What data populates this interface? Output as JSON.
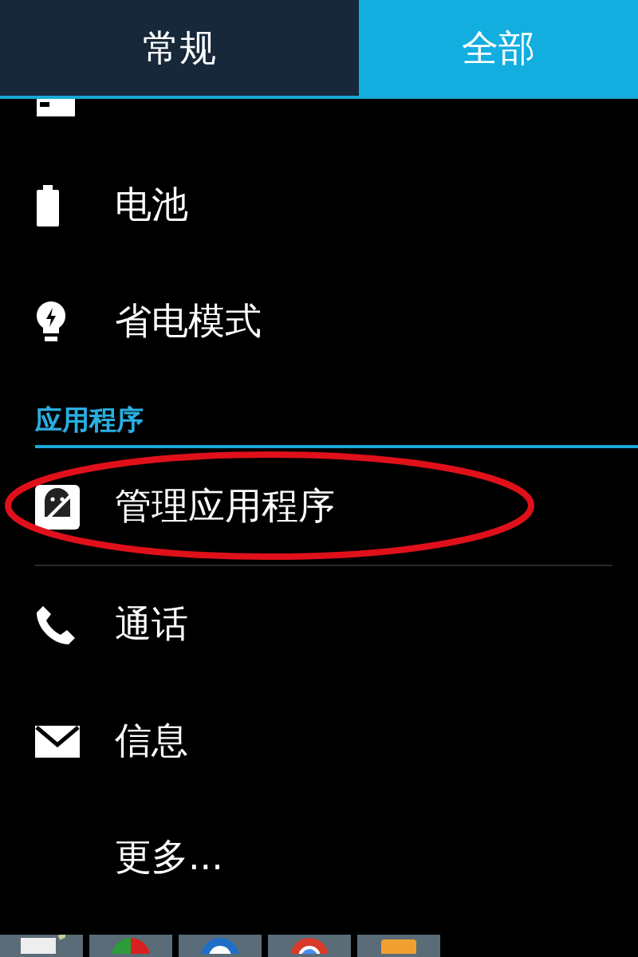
{
  "tabs": [
    {
      "label": "常规",
      "selected": false
    },
    {
      "label": "全部",
      "selected": true
    }
  ],
  "sections": [
    {
      "items": [
        {
          "kind": "storage",
          "clipped": true
        },
        {
          "kind": "battery",
          "label": "电池"
        },
        {
          "kind": "bulb",
          "label": "省电模式"
        }
      ]
    },
    {
      "header": "应用程序",
      "items": [
        {
          "kind": "apps",
          "label": "管理应用程序",
          "circled": true
        },
        {
          "kind": "phone",
          "label": "通话"
        },
        {
          "kind": "mail",
          "label": "信息"
        },
        {
          "kind": "none",
          "label": "更多..."
        }
      ]
    }
  ],
  "taskbar": {
    "icons": [
      {
        "kind": "notepad"
      },
      {
        "kind": "ball"
      },
      {
        "kind": "globe"
      },
      {
        "kind": "chrome"
      },
      {
        "kind": "folder"
      }
    ]
  }
}
